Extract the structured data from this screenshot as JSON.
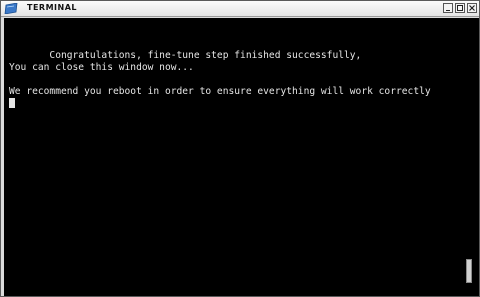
{
  "window": {
    "title": "TERMINAL",
    "icons": {
      "app": "terminal-icon",
      "minimize": "minimize-icon",
      "maximize": "maximize-icon",
      "close": "close-icon"
    }
  },
  "terminal": {
    "lines": [
      "       Congratulations, fine-tune step finished successfully,",
      "You can close this window now...",
      "",
      "We recommend you reboot in order to ensure everything will work correctly"
    ],
    "colors": {
      "background": "#000000",
      "foreground": "#e6e6e6"
    }
  }
}
